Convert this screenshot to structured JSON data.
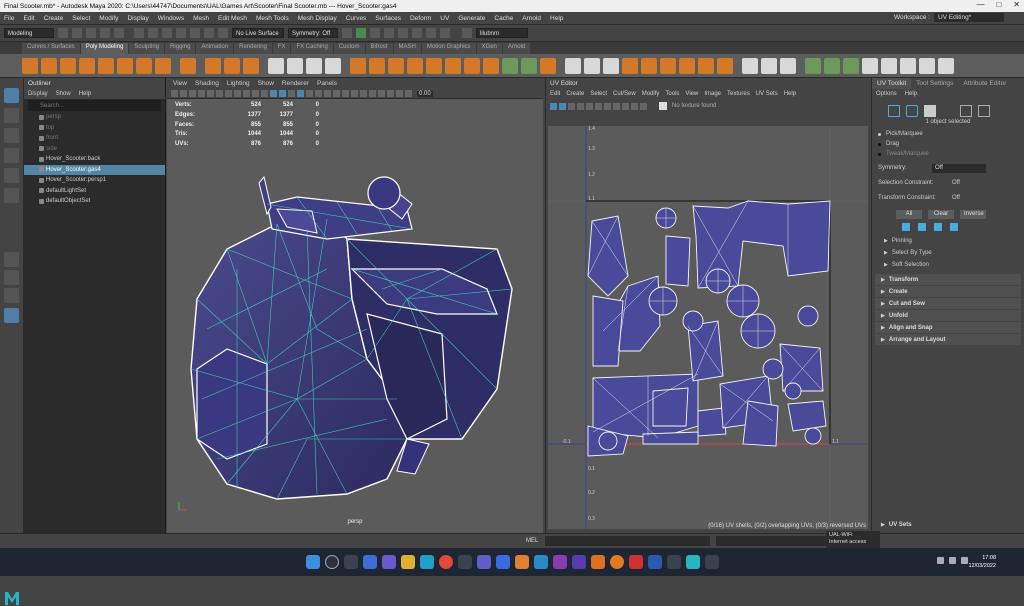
{
  "title_bar": {
    "title": "Final Scooter.mb* - Autodesk Maya 2020: C:\\Users\\44747\\Documents\\UAL\\Games Art\\Scooter\\Final Scooter.mb   ---   Hover_Scooter:gas4",
    "minimize": "—",
    "maximize": "□",
    "close": "✕"
  },
  "menu_bar": {
    "items": [
      "File",
      "Edit",
      "Create",
      "Select",
      "Modify",
      "Display",
      "Windows",
      "Mesh",
      "Edit Mesh",
      "Mesh Tools",
      "Mesh Display",
      "Curves",
      "Surfaces",
      "Deform",
      "UV",
      "Generate",
      "Cache",
      "Arnold",
      "Help"
    ],
    "workspace_label": "Workspace :",
    "workspace_value": "UV Editing*"
  },
  "status_line": {
    "mode": "Modeling",
    "live_surface": "No Live Surface",
    "symmetry": "Symmetry: Off",
    "user": "lilubnm"
  },
  "shelf_tabs": [
    "Curves / Surfaces",
    "Poly Modeling",
    "Sculpting",
    "Rigging",
    "Animation",
    "Rendering",
    "FX",
    "FX Caching",
    "Custom",
    "Bifrost",
    "MASH",
    "Motion Graphics",
    "XGen",
    "Arnold"
  ],
  "outliner": {
    "title": "Outliner",
    "menu": [
      "Display",
      "Show",
      "Help"
    ],
    "search_placeholder": "Search...",
    "items": [
      {
        "label": "persp",
        "state": "dim"
      },
      {
        "label": "top",
        "state": "dim"
      },
      {
        "label": "front",
        "state": "dim"
      },
      {
        "label": "side",
        "state": "dim"
      },
      {
        "label": "Hover_Scooter:back",
        "state": "normal"
      },
      {
        "label": "Hover_Scooter:gas4",
        "state": "selected"
      },
      {
        "label": "Hover_Scooter:persp1",
        "state": "normal"
      },
      {
        "label": "defaultLightSet",
        "state": "normal"
      },
      {
        "label": "defaultObjectSet",
        "state": "normal"
      }
    ]
  },
  "viewport": {
    "menu": [
      "View",
      "Shading",
      "Lighting",
      "Show",
      "Renderer",
      "Panels"
    ],
    "exposure": "0.00",
    "stats": [
      {
        "label": "Verts:",
        "a": "524",
        "b": "524",
        "c": "0"
      },
      {
        "label": "Edges:",
        "a": "1377",
        "b": "1377",
        "c": "0"
      },
      {
        "label": "Faces:",
        "a": "855",
        "b": "855",
        "c": "0"
      },
      {
        "label": "Tris:",
        "a": "1044",
        "b": "1044",
        "c": "0"
      },
      {
        "label": "UVs:",
        "a": "876",
        "b": "876",
        "c": "0"
      }
    ],
    "camera": "persp"
  },
  "uv_editor": {
    "title": "UV Editor",
    "menu": [
      "Edit",
      "Create",
      "Select",
      "Cut/Sew",
      "Modify",
      "Tools",
      "View",
      "Image",
      "Textures",
      "UV Sets",
      "Help"
    ],
    "texture": "No texture found",
    "status": "(0/16) UV shells, (0/2) overlapping UVs, (0/3) reversed UVs",
    "axis_labels": [
      "1.4",
      "1.3",
      "1.2",
      "1.1",
      "0.1",
      "0.2",
      "0.3",
      "-0.1",
      "-0.1",
      "1.1"
    ]
  },
  "uv_toolkit": {
    "tabs": [
      "UV Toolkit",
      "Tool Settings",
      "Attribute Editor"
    ],
    "menu": [
      "Options",
      "Help"
    ],
    "selection_info": "1 object selected",
    "pick_modes": [
      "Pick/Marquee",
      "Drag",
      "Tweak/Marquee"
    ],
    "symmetry_label": "Symmetry:",
    "symmetry_value": "Off",
    "selection_constraint_label": "Selection Constraint:",
    "selection_constraint_value": "Off",
    "transform_constraint_label": "Transform Constraint:",
    "transform_constraint_value": "Off",
    "buttons": [
      "All",
      "Clear",
      "Inverse"
    ],
    "subsections": [
      "Pinning",
      "Select By Type",
      "Soft Selection"
    ],
    "sections": [
      "Transform",
      "Create",
      "Cut and Sew",
      "Unfold",
      "Align and Snap",
      "Arrange and Layout"
    ],
    "uv_sets": "UV Sets"
  },
  "command_line": {
    "lang": "MEL"
  },
  "tooltip": {
    "line1": "UAL-WiFi",
    "line2": "Internet access"
  },
  "taskbar": {
    "time": "17:08",
    "date": "12/03/2022"
  },
  "colors": {
    "accent_orange": "#d4782a",
    "selection_blue": "#5285a6",
    "mesh_fill": "#3b3a78",
    "wire_cyan": "#40e0c0",
    "uv_shell_fill": "#4a4a9a"
  }
}
